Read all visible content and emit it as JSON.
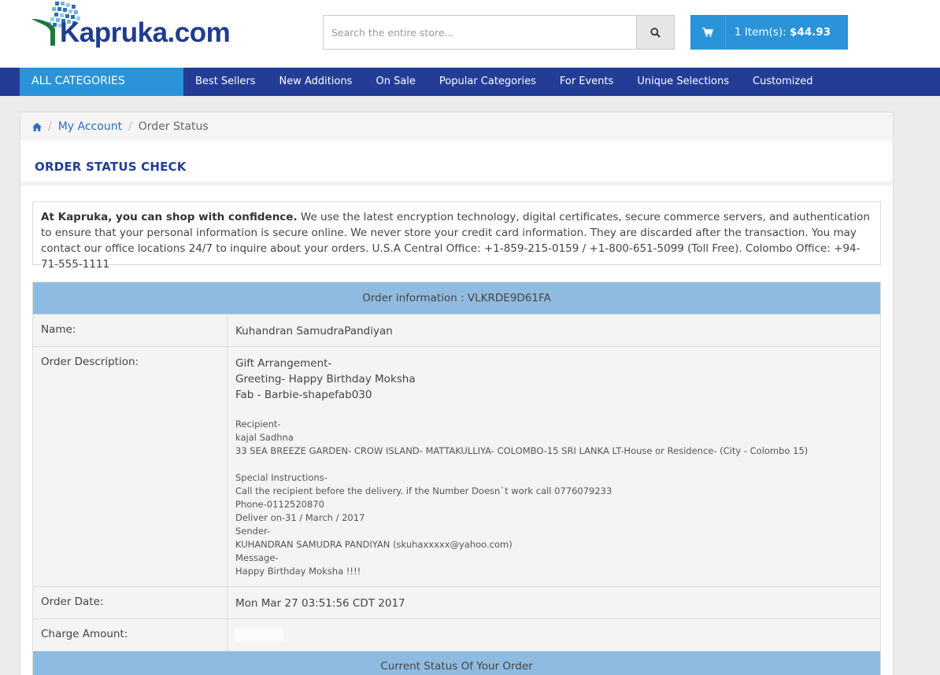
{
  "header": {
    "logo_text": "Kapruka.com",
    "search_placeholder": "Search the entire store...",
    "cart_items": "1 Item(s):",
    "cart_total": "$44.93"
  },
  "nav": {
    "all_categories": "ALL CATEGORIES",
    "items": [
      "Best Sellers",
      "New Additions",
      "On Sale",
      "Popular Categories",
      "For Events",
      "Unique Selections",
      "Customized"
    ]
  },
  "breadcrumb": {
    "home_icon": "home-icon",
    "my_account": "My Account",
    "current": "Order Status"
  },
  "page_title": "ORDER STATUS CHECK",
  "notice": {
    "lead": "At Kapruka, you can shop with confidence.",
    "body": " We use the latest encryption technology, digital certificates, secure commerce servers, and authentication to ensure that your personal information is secure online. We never store your credit card information. They are discarded after the transaction. You may contact our office locations 24/7 to inquire about your orders. U.S.A Central Office: +1-859-215-0159 / +1-800-651-5099 (Toll Free). Colombo Office: +94-71-555-1111"
  },
  "order": {
    "header": "Order information : VLKRDE9D61FA",
    "name_label": "Name:",
    "name_value": "Kuhandran SamudraPandiyan",
    "desc_label": "Order Description:",
    "desc_main": [
      "Gift Arrangement-",
      "Greeting- Happy Birthday Moksha",
      "Fab - Barbie-shapefab030"
    ],
    "desc_recipient": [
      "Recipient-",
      "kajal Sadhna",
      "33 SEA BREEZE GARDEN- CROW ISLAND- MATTAKULLIYA- COLOMBO-15 SRI LANKA LT-House or Residence- (City - Colombo 15)"
    ],
    "desc_special": [
      "Special Instructions-",
      "Call the recipient before the delivery. if the Number Doesn`t work call 0776079233",
      "Phone-0112520870",
      "Deliver on-31 / March / 2017",
      "Sender-",
      "KUHANDRAN SAMUDRA PANDIYAN (skuhaxxxxx@yahoo.com)",
      "Message-",
      "Happy Birthday Moksha !!!!"
    ],
    "date_label": "Order Date:",
    "date_value": "Mon Mar 27 03:51:56 CDT 2017",
    "charge_label": "Charge Amount:",
    "status_header": "Current Status Of Your Order"
  },
  "colors": {
    "brand_navy": "#233d96",
    "accent_blue": "#2b93d9",
    "table_header": "#90bbe0"
  }
}
